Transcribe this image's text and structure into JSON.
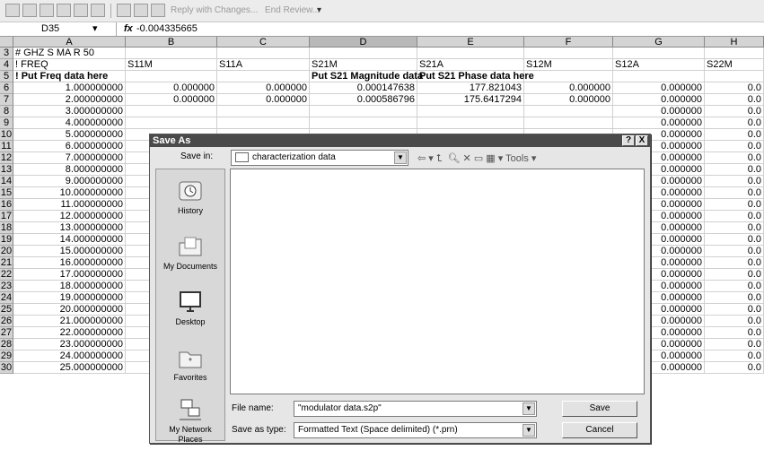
{
  "toolbar": {
    "reply_label": "Reply with Changes...",
    "end_review_label": "End Review..."
  },
  "formula_bar": {
    "name_box": "D35",
    "fx": "fx",
    "value": "-0.004335665"
  },
  "columns": [
    "A",
    "B",
    "C",
    "D",
    "E",
    "F",
    "G",
    "H"
  ],
  "rows": [
    {
      "n": "3",
      "cells": [
        "# GHZ S MA R 50",
        "",
        "",
        "",
        "",
        "",
        "",
        ""
      ]
    },
    {
      "n": "4",
      "cells": [
        "! FREQ",
        "S11M",
        "S11A",
        "S21M",
        "S21A",
        "S12M",
        "S12A",
        "S22M"
      ]
    },
    {
      "n": "5",
      "cells": [
        "! Put Freq data here",
        "",
        "",
        "Put S21 Magnitude data",
        "Put S21 Phase data here",
        "",
        "",
        ""
      ]
    },
    {
      "n": "6",
      "cells": [
        "1.000000000",
        "0.000000",
        "0.000000",
        "0.000147638",
        "177.821043",
        "0.000000",
        "0.000000",
        "0.0"
      ]
    },
    {
      "n": "7",
      "cells": [
        "2.000000000",
        "0.000000",
        "0.000000",
        "0.000586796",
        "175.6417294",
        "0.000000",
        "0.000000",
        "0.0"
      ]
    },
    {
      "n": "8",
      "cells": [
        "3.000000000",
        "",
        "",
        "",
        "",
        "",
        "0.000000",
        "0.0"
      ]
    },
    {
      "n": "9",
      "cells": [
        "4.000000000",
        "",
        "",
        "",
        "",
        "",
        "0.000000",
        "0.0"
      ]
    },
    {
      "n": "10",
      "cells": [
        "5.000000000",
        "",
        "",
        "",
        "",
        "",
        "0.000000",
        "0.0"
      ]
    },
    {
      "n": "11",
      "cells": [
        "6.000000000",
        "",
        "",
        "",
        "",
        "",
        "0.000000",
        "0.0"
      ]
    },
    {
      "n": "12",
      "cells": [
        "7.000000000",
        "",
        "",
        "",
        "",
        "",
        "0.000000",
        "0.0"
      ]
    },
    {
      "n": "13",
      "cells": [
        "8.000000000",
        "",
        "",
        "",
        "",
        "",
        "0.000000",
        "0.0"
      ]
    },
    {
      "n": "14",
      "cells": [
        "9.000000000",
        "",
        "",
        "",
        "",
        "",
        "0.000000",
        "0.0"
      ]
    },
    {
      "n": "15",
      "cells": [
        "10.000000000",
        "",
        "",
        "",
        "",
        "",
        "0.000000",
        "0.0"
      ]
    },
    {
      "n": "16",
      "cells": [
        "11.000000000",
        "",
        "",
        "",
        "",
        "",
        "0.000000",
        "0.0"
      ]
    },
    {
      "n": "17",
      "cells": [
        "12.000000000",
        "",
        "",
        "",
        "",
        "",
        "0.000000",
        "0.0"
      ]
    },
    {
      "n": "18",
      "cells": [
        "13.000000000",
        "",
        "",
        "",
        "",
        "",
        "0.000000",
        "0.0"
      ]
    },
    {
      "n": "19",
      "cells": [
        "14.000000000",
        "",
        "",
        "",
        "",
        "",
        "0.000000",
        "0.0"
      ]
    },
    {
      "n": "20",
      "cells": [
        "15.000000000",
        "",
        "",
        "",
        "",
        "",
        "0.000000",
        "0.0"
      ]
    },
    {
      "n": "21",
      "cells": [
        "16.000000000",
        "",
        "",
        "",
        "",
        "",
        "0.000000",
        "0.0"
      ]
    },
    {
      "n": "22",
      "cells": [
        "17.000000000",
        "",
        "",
        "",
        "",
        "",
        "0.000000",
        "0.0"
      ]
    },
    {
      "n": "23",
      "cells": [
        "18.000000000",
        "",
        "",
        "",
        "",
        "",
        "0.000000",
        "0.0"
      ]
    },
    {
      "n": "24",
      "cells": [
        "19.000000000",
        "",
        "",
        "",
        "",
        "",
        "0.000000",
        "0.0"
      ]
    },
    {
      "n": "25",
      "cells": [
        "20.000000000",
        "",
        "",
        "",
        "",
        "",
        "0.000000",
        "0.0"
      ]
    },
    {
      "n": "26",
      "cells": [
        "21.000000000",
        "",
        "",
        "",
        "",
        "",
        "0.000000",
        "0.0"
      ]
    },
    {
      "n": "27",
      "cells": [
        "22.000000000",
        "",
        "",
        "",
        "",
        "",
        "0.000000",
        "0.0"
      ]
    },
    {
      "n": "28",
      "cells": [
        "23.000000000",
        "",
        "",
        "",
        "",
        "",
        "0.000000",
        "0.0"
      ]
    },
    {
      "n": "29",
      "cells": [
        "24.000000000",
        "",
        "",
        "",
        "",
        "",
        "0.000000",
        "0.0"
      ]
    },
    {
      "n": "30",
      "cells": [
        "25.000000000",
        "",
        "",
        "",
        "",
        "",
        "0.000000",
        "0.0"
      ]
    }
  ],
  "dialog": {
    "title": "Save As",
    "help_btn": "?",
    "close_btn": "X",
    "save_in_label": "Save in:",
    "save_in_value": "characterization data",
    "tools_label": "Tools",
    "places": [
      {
        "label": "History",
        "icon": "history-icon"
      },
      {
        "label": "My Documents",
        "icon": "my-documents-icon"
      },
      {
        "label": "Desktop",
        "icon": "desktop-icon"
      },
      {
        "label": "Favorites",
        "icon": "favorites-icon"
      },
      {
        "label": "My Network Places",
        "icon": "network-places-icon"
      }
    ],
    "file_name_label": "File name:",
    "file_name_value": "\"modulator data.s2p\"",
    "save_type_label": "Save as type:",
    "save_type_value": "Formatted Text (Space delimited) (*.prn)",
    "save_btn": "Save",
    "cancel_btn": "Cancel"
  }
}
